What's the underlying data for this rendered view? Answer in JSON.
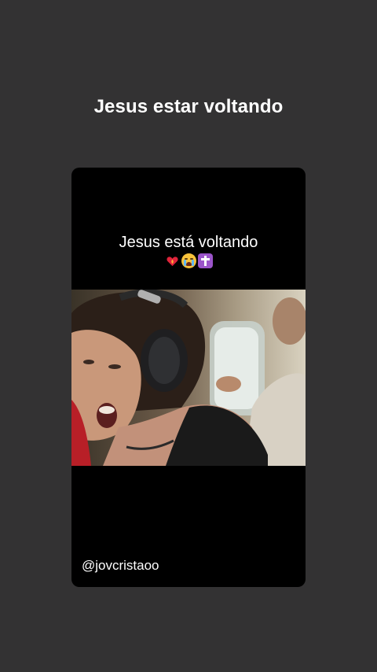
{
  "story": {
    "title": "Jesus estar voltando"
  },
  "card": {
    "caption": "Jesus está voltando",
    "emojis": [
      "heart-on-fire-icon",
      "loudly-crying-face-icon",
      "latin-cross-icon"
    ],
    "handle": "@jovcristaoo"
  },
  "colors": {
    "background": "#333233",
    "card": "#000000",
    "text": "#ffffff"
  }
}
